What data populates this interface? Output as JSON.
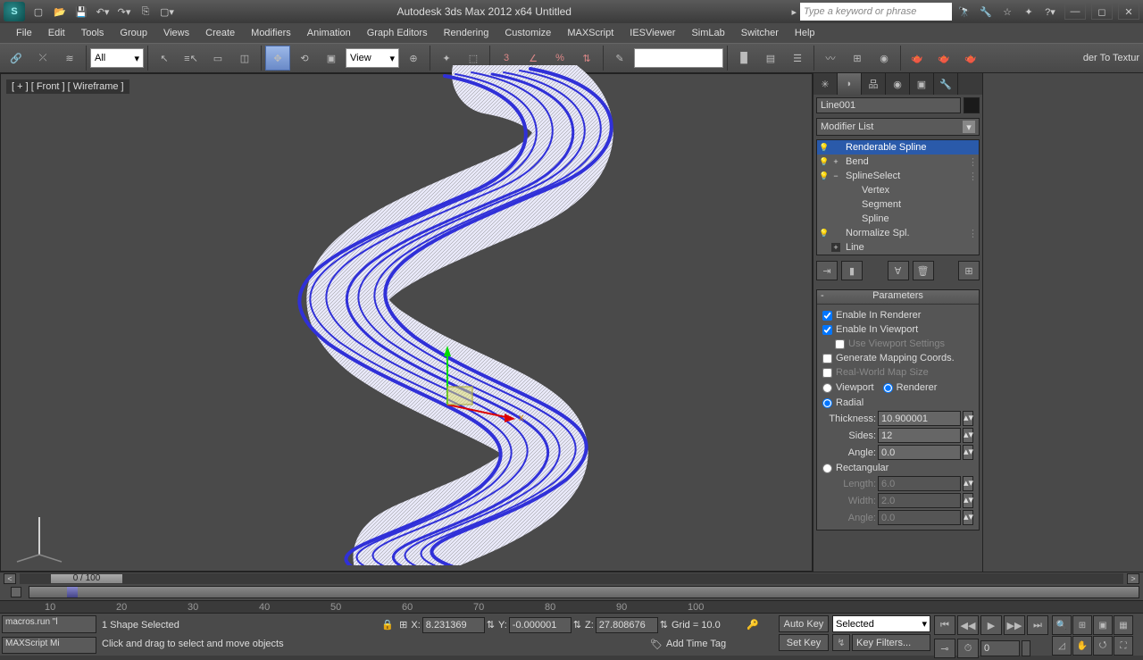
{
  "titlebar": {
    "title": "Autodesk 3ds Max  2012 x64     Untitled",
    "search_placeholder": "Type a keyword or phrase"
  },
  "menu": [
    "File",
    "Edit",
    "Tools",
    "Group",
    "Views",
    "Create",
    "Modifiers",
    "Animation",
    "Graph Editors",
    "Rendering",
    "Customize",
    "MAXScript",
    "IESViewer",
    "SimLab",
    "Switcher",
    "Help"
  ],
  "toolbar": {
    "filter_sel": "All",
    "ref_sel": "View",
    "named_brand": "der To Textur"
  },
  "viewport": {
    "label": "[ + ] [ Front ] [ Wireframe ]"
  },
  "cmdpanel": {
    "object_name": "Line001",
    "modifier_list": "Modifier List",
    "stack": [
      {
        "name": "Renderable Spline",
        "bulb": true,
        "sel": true,
        "exp": ""
      },
      {
        "name": "Bend",
        "bulb": true,
        "exp": "+",
        "grip": true
      },
      {
        "name": "SplineSelect",
        "bulb": true,
        "exp": "−",
        "grip": true
      },
      {
        "name": "Vertex",
        "sub": true
      },
      {
        "name": "Segment",
        "sub": true
      },
      {
        "name": "Spline",
        "sub": true
      },
      {
        "name": "Normalize Spl.",
        "bulb": true,
        "grip": true
      },
      {
        "name": "Line",
        "exp": "+",
        "base": true
      }
    ],
    "rollup_title": "Parameters",
    "params": {
      "enable_renderer": "Enable In Renderer",
      "enable_viewport": "Enable In Viewport",
      "use_viewport": "Use Viewport Settings",
      "gen_mapping": "Generate Mapping Coords.",
      "real_world": "Real-World Map Size",
      "display_vp": "Viewport",
      "display_rn": "Renderer",
      "radial": "Radial",
      "thickness_lbl": "Thickness:",
      "thickness_val": "10.900001",
      "sides_lbl": "Sides:",
      "sides_val": "12",
      "angle_lbl": "Angle:",
      "angle_val": "0.0",
      "rectangular": "Rectangular",
      "length_lbl": "Length:",
      "length_val": "6.0",
      "width_lbl": "Width:",
      "width_val": "2.0",
      "angle2_lbl": "Angle:",
      "angle2_val": "0.0"
    }
  },
  "timeline": {
    "thumb": "0 / 100",
    "ticks": [
      "10",
      "20",
      "30",
      "40",
      "50",
      "60",
      "70",
      "80",
      "90",
      "100"
    ]
  },
  "status": {
    "script_line": "macros.run \"l",
    "listener": "MAXScript Mi",
    "selection": "1 Shape Selected",
    "prompt": "Click and drag to select and move objects",
    "x": "8.231369",
    "y": "-0.000001",
    "z": "27.808676",
    "grid": "Grid = 10.0",
    "timetag": "Add Time Tag",
    "autokey": "Auto Key",
    "setkey": "Set Key",
    "filter_sel": "Selected",
    "keyfilters": "Key Filters...",
    "frame": "0"
  }
}
